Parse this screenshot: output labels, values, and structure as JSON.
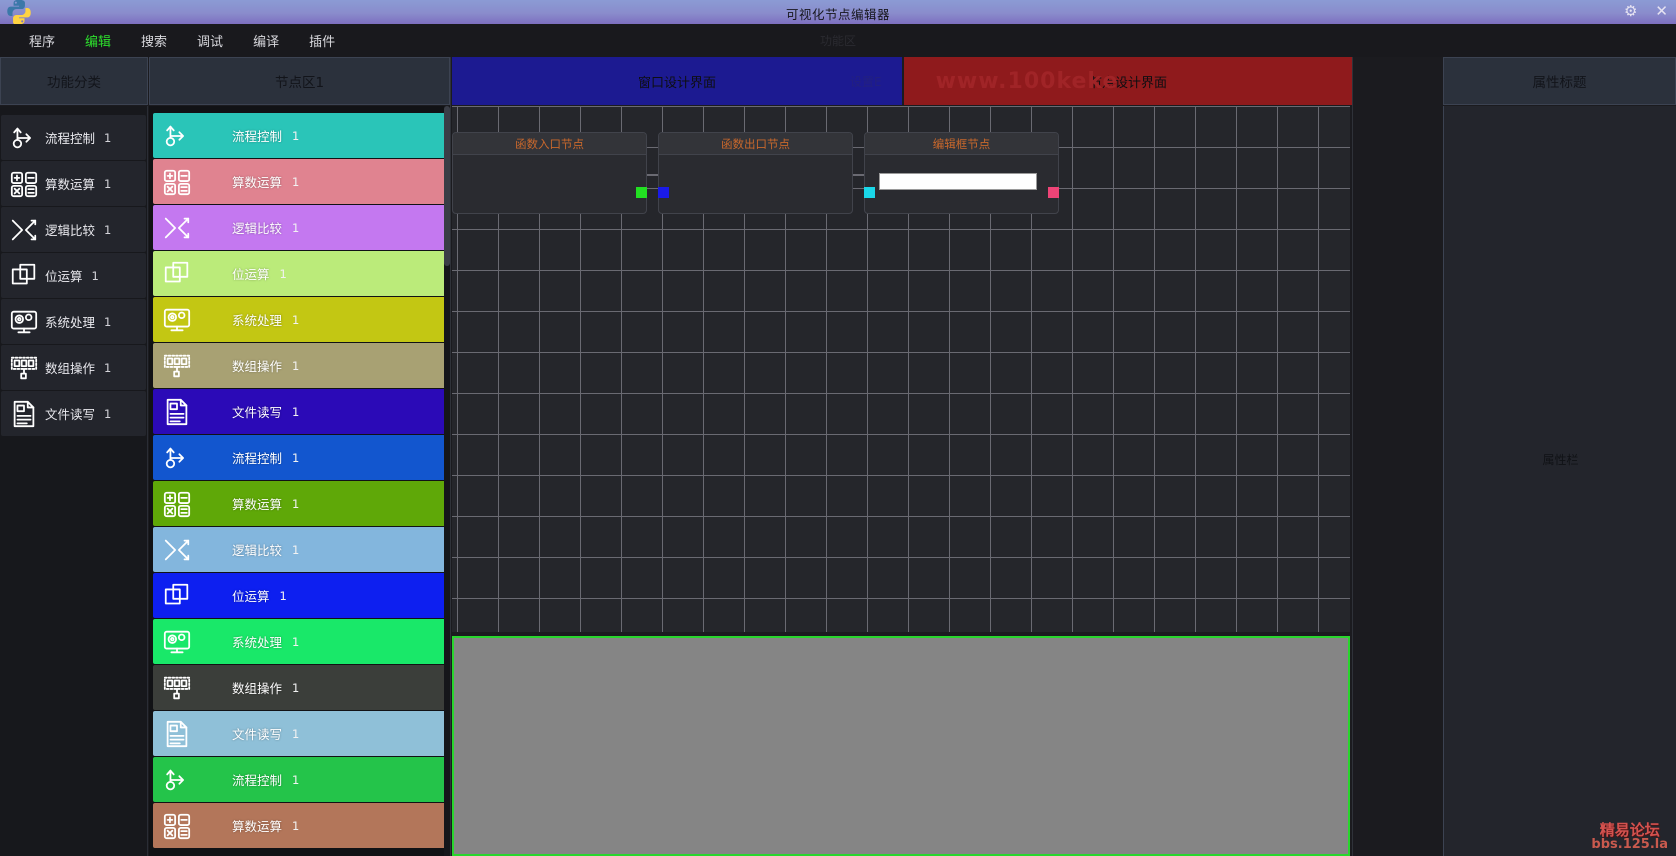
{
  "window": {
    "title": "可视化节点编辑器",
    "logo_icon": "python-logo-icon",
    "settings_icon": "gear-icon",
    "close_icon": "close-icon"
  },
  "menubar": {
    "items": [
      {
        "label": "程序",
        "active": false
      },
      {
        "label": "编辑",
        "active": true
      },
      {
        "label": "搜索",
        "active": false
      },
      {
        "label": "调试",
        "active": false
      },
      {
        "label": "编译",
        "active": false
      },
      {
        "label": "插件",
        "active": false
      }
    ],
    "zone_label": "功能区"
  },
  "category_panel": {
    "header": "功能分类",
    "items": [
      {
        "label": "流程控制",
        "count": "1",
        "icon": "flow-control-icon"
      },
      {
        "label": "算数运算",
        "count": "1",
        "icon": "calculator-icon"
      },
      {
        "label": "逻辑比较",
        "count": "1",
        "icon": "shuffle-icon"
      },
      {
        "label": "位运算",
        "count": "1",
        "icon": "layers-icon"
      },
      {
        "label": "系统处理",
        "count": "1",
        "icon": "monitor-gear-icon"
      },
      {
        "label": "数组操作",
        "count": "1",
        "icon": "array-icon"
      },
      {
        "label": "文件读写",
        "count": "1",
        "icon": "file-icon"
      }
    ]
  },
  "node_panel": {
    "header": "节点区1",
    "items": [
      {
        "label": "流程控制",
        "count": "1",
        "icon": "flow-control-icon",
        "color": "#2ac5b8"
      },
      {
        "label": "算数运算",
        "count": "1",
        "icon": "calculator-icon",
        "color": "#e08390"
      },
      {
        "label": "逻辑比较",
        "count": "1",
        "icon": "shuffle-icon",
        "color": "#c478f0"
      },
      {
        "label": "位运算",
        "count": "1",
        "icon": "layers-icon",
        "color": "#bbeb7a"
      },
      {
        "label": "系统处理",
        "count": "1",
        "icon": "monitor-gear-icon",
        "color": "#c3c713"
      },
      {
        "label": "数组操作",
        "count": "1",
        "icon": "array-icon",
        "color": "#a8a173"
      },
      {
        "label": "文件读写",
        "count": "1",
        "icon": "file-icon",
        "color": "#2b0ab7"
      },
      {
        "label": "流程控制",
        "count": "1",
        "icon": "flow-control-icon",
        "color": "#1256cf"
      },
      {
        "label": "算数运算",
        "count": "1",
        "icon": "calculator-icon",
        "color": "#5fa808"
      },
      {
        "label": "逻辑比较",
        "count": "1",
        "icon": "shuffle-icon",
        "color": "#83b6dd"
      },
      {
        "label": "位运算",
        "count": "1",
        "icon": "layers-icon",
        "color": "#0d1ff0"
      },
      {
        "label": "系统处理",
        "count": "1",
        "icon": "monitor-gear-icon",
        "color": "#19e869"
      },
      {
        "label": "数组操作",
        "count": "1",
        "icon": "array-icon",
        "color": "#3b3e3a"
      },
      {
        "label": "文件读写",
        "count": "1",
        "icon": "file-icon",
        "color": "#8fc0d8"
      },
      {
        "label": "流程控制",
        "count": "1",
        "icon": "flow-control-icon",
        "color": "#24c44a"
      },
      {
        "label": "算数运算",
        "count": "1",
        "icon": "calculator-icon",
        "color": "#b3765a"
      }
    ]
  },
  "tabs": {
    "window_design": "窗口设计界面",
    "node_design": "节点设计界面",
    "overlap_label": "设置E",
    "watermark_top": "www.100keke"
  },
  "canvas": {
    "nodes": [
      {
        "title": "函数入口节点",
        "out_port_color": "#22e022",
        "has_edit_box": false
      },
      {
        "title": "函数出口节点",
        "in_port_color": "#1a1ae8",
        "has_edit_box": false
      },
      {
        "title": "编辑框节点",
        "in_port_color": "#1ad7e8",
        "out_port_color": "#ee4477",
        "has_edit_box": true,
        "edit_box_value": ""
      }
    ]
  },
  "property_panel": {
    "header": "属性标题",
    "body_label": "属性栏"
  },
  "watermark_bottom": {
    "line1": "精易论坛",
    "line2": "bbs.125.la"
  }
}
